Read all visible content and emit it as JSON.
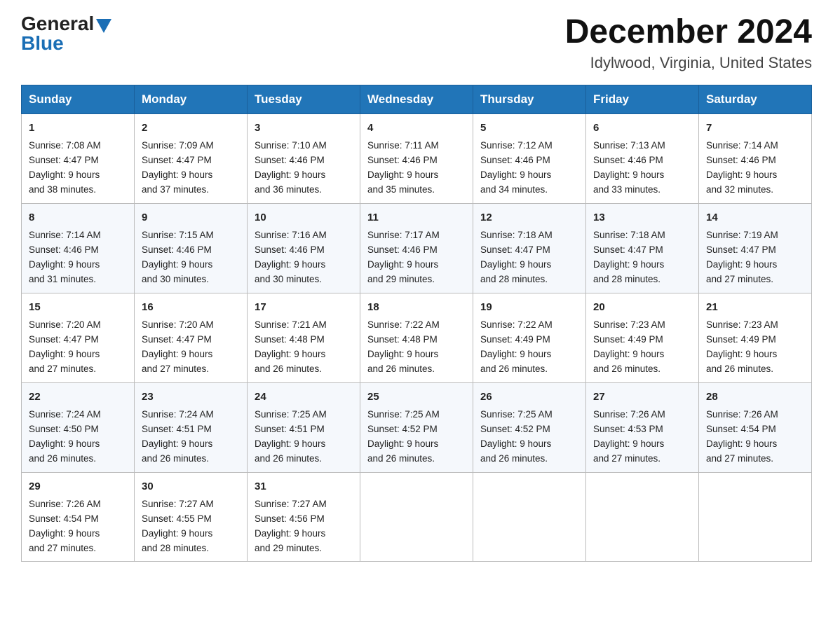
{
  "header": {
    "logo_general": "General",
    "logo_blue": "Blue",
    "month_title": "December 2024",
    "location": "Idylwood, Virginia, United States"
  },
  "weekdays": [
    "Sunday",
    "Monday",
    "Tuesday",
    "Wednesday",
    "Thursday",
    "Friday",
    "Saturday"
  ],
  "weeks": [
    [
      {
        "day": "1",
        "sunrise": "7:08 AM",
        "sunset": "4:47 PM",
        "daylight": "9 hours and 38 minutes."
      },
      {
        "day": "2",
        "sunrise": "7:09 AM",
        "sunset": "4:47 PM",
        "daylight": "9 hours and 37 minutes."
      },
      {
        "day": "3",
        "sunrise": "7:10 AM",
        "sunset": "4:46 PM",
        "daylight": "9 hours and 36 minutes."
      },
      {
        "day": "4",
        "sunrise": "7:11 AM",
        "sunset": "4:46 PM",
        "daylight": "9 hours and 35 minutes."
      },
      {
        "day": "5",
        "sunrise": "7:12 AM",
        "sunset": "4:46 PM",
        "daylight": "9 hours and 34 minutes."
      },
      {
        "day": "6",
        "sunrise": "7:13 AM",
        "sunset": "4:46 PM",
        "daylight": "9 hours and 33 minutes."
      },
      {
        "day": "7",
        "sunrise": "7:14 AM",
        "sunset": "4:46 PM",
        "daylight": "9 hours and 32 minutes."
      }
    ],
    [
      {
        "day": "8",
        "sunrise": "7:14 AM",
        "sunset": "4:46 PM",
        "daylight": "9 hours and 31 minutes."
      },
      {
        "day": "9",
        "sunrise": "7:15 AM",
        "sunset": "4:46 PM",
        "daylight": "9 hours and 30 minutes."
      },
      {
        "day": "10",
        "sunrise": "7:16 AM",
        "sunset": "4:46 PM",
        "daylight": "9 hours and 30 minutes."
      },
      {
        "day": "11",
        "sunrise": "7:17 AM",
        "sunset": "4:46 PM",
        "daylight": "9 hours and 29 minutes."
      },
      {
        "day": "12",
        "sunrise": "7:18 AM",
        "sunset": "4:47 PM",
        "daylight": "9 hours and 28 minutes."
      },
      {
        "day": "13",
        "sunrise": "7:18 AM",
        "sunset": "4:47 PM",
        "daylight": "9 hours and 28 minutes."
      },
      {
        "day": "14",
        "sunrise": "7:19 AM",
        "sunset": "4:47 PM",
        "daylight": "9 hours and 27 minutes."
      }
    ],
    [
      {
        "day": "15",
        "sunrise": "7:20 AM",
        "sunset": "4:47 PM",
        "daylight": "9 hours and 27 minutes."
      },
      {
        "day": "16",
        "sunrise": "7:20 AM",
        "sunset": "4:47 PM",
        "daylight": "9 hours and 27 minutes."
      },
      {
        "day": "17",
        "sunrise": "7:21 AM",
        "sunset": "4:48 PM",
        "daylight": "9 hours and 26 minutes."
      },
      {
        "day": "18",
        "sunrise": "7:22 AM",
        "sunset": "4:48 PM",
        "daylight": "9 hours and 26 minutes."
      },
      {
        "day": "19",
        "sunrise": "7:22 AM",
        "sunset": "4:49 PM",
        "daylight": "9 hours and 26 minutes."
      },
      {
        "day": "20",
        "sunrise": "7:23 AM",
        "sunset": "4:49 PM",
        "daylight": "9 hours and 26 minutes."
      },
      {
        "day": "21",
        "sunrise": "7:23 AM",
        "sunset": "4:49 PM",
        "daylight": "9 hours and 26 minutes."
      }
    ],
    [
      {
        "day": "22",
        "sunrise": "7:24 AM",
        "sunset": "4:50 PM",
        "daylight": "9 hours and 26 minutes."
      },
      {
        "day": "23",
        "sunrise": "7:24 AM",
        "sunset": "4:51 PM",
        "daylight": "9 hours and 26 minutes."
      },
      {
        "day": "24",
        "sunrise": "7:25 AM",
        "sunset": "4:51 PM",
        "daylight": "9 hours and 26 minutes."
      },
      {
        "day": "25",
        "sunrise": "7:25 AM",
        "sunset": "4:52 PM",
        "daylight": "9 hours and 26 minutes."
      },
      {
        "day": "26",
        "sunrise": "7:25 AM",
        "sunset": "4:52 PM",
        "daylight": "9 hours and 26 minutes."
      },
      {
        "day": "27",
        "sunrise": "7:26 AM",
        "sunset": "4:53 PM",
        "daylight": "9 hours and 27 minutes."
      },
      {
        "day": "28",
        "sunrise": "7:26 AM",
        "sunset": "4:54 PM",
        "daylight": "9 hours and 27 minutes."
      }
    ],
    [
      {
        "day": "29",
        "sunrise": "7:26 AM",
        "sunset": "4:54 PM",
        "daylight": "9 hours and 27 minutes."
      },
      {
        "day": "30",
        "sunrise": "7:27 AM",
        "sunset": "4:55 PM",
        "daylight": "9 hours and 28 minutes."
      },
      {
        "day": "31",
        "sunrise": "7:27 AM",
        "sunset": "4:56 PM",
        "daylight": "9 hours and 29 minutes."
      },
      null,
      null,
      null,
      null
    ]
  ],
  "labels": {
    "sunrise": "Sunrise:",
    "sunset": "Sunset:",
    "daylight": "Daylight:"
  }
}
